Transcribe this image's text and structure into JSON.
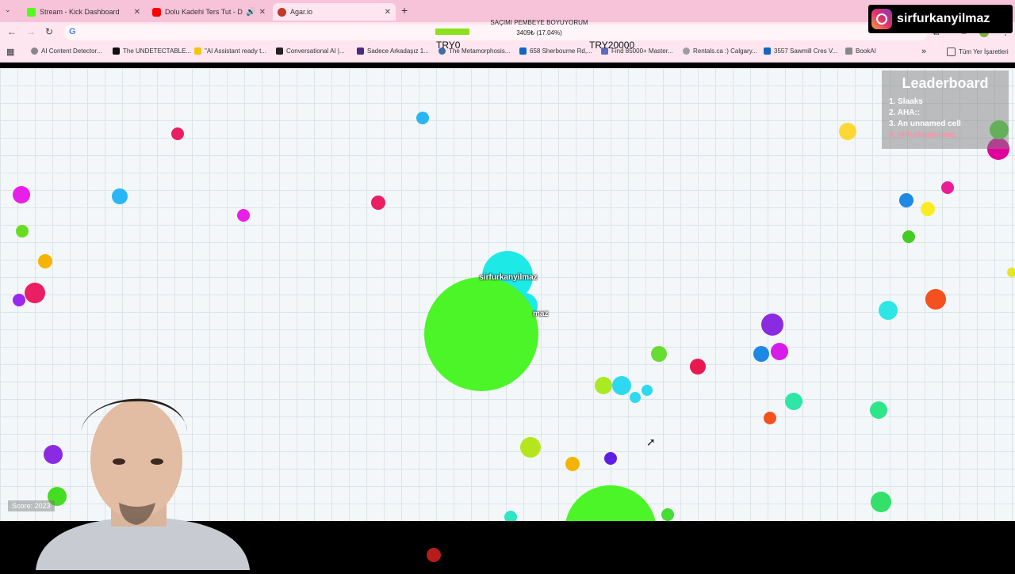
{
  "browser": {
    "tabs": [
      {
        "label": "Stream - Kick Dashboard",
        "icon": "kick-icon",
        "color": "#53fc18"
      },
      {
        "label": "Dolu Kadehi Ters Tut - Dile",
        "icon": "youtube-icon",
        "color": "#ff0000"
      },
      {
        "label": "Agar.io",
        "icon": "agario-icon",
        "color": "#c0392b"
      }
    ],
    "bookmarks": [
      "AI Content Detector...",
      "The UNDETECTABLE...",
      "\"AI Assistant ready t...",
      "Conversational AI |...",
      "Sadece Arkadaşız 1...",
      "The Metamorphosis...",
      "658 Sherbourne Rd,...",
      "Find 85000+ Master...",
      "Rentals.ca :) Calgary...",
      "3557 Sawmill Cres V...",
      "BookAI"
    ],
    "all_bookmarks": "Tüm Yer İşaretleri"
  },
  "stream_overlay": {
    "goal_title": "SAÇIMI PEMBEYE BOYUYORUM",
    "goal_progress": "3409₺ (17.04%)",
    "goal_fraction": 0.1704,
    "try_start": "TRY0",
    "try_goal": "TRY20000",
    "instagram": "sirfurkanyilmaz"
  },
  "game": {
    "player_name": "sirfurkanyilmaz",
    "split_label": "maz",
    "score": "Score: 2023",
    "leaderboard": {
      "title": "Leaderboard",
      "entries": [
        "1. Slaaks",
        "2. AHA::",
        "3. An unnamed cell",
        "4. sirfurkanyilmaz"
      ]
    }
  },
  "colors": {
    "player_green": "#4cf527",
    "player_cyan": "#1de9e6",
    "grid_bg": "#f3f7f9",
    "tab_bar": "#f7c3d9"
  }
}
